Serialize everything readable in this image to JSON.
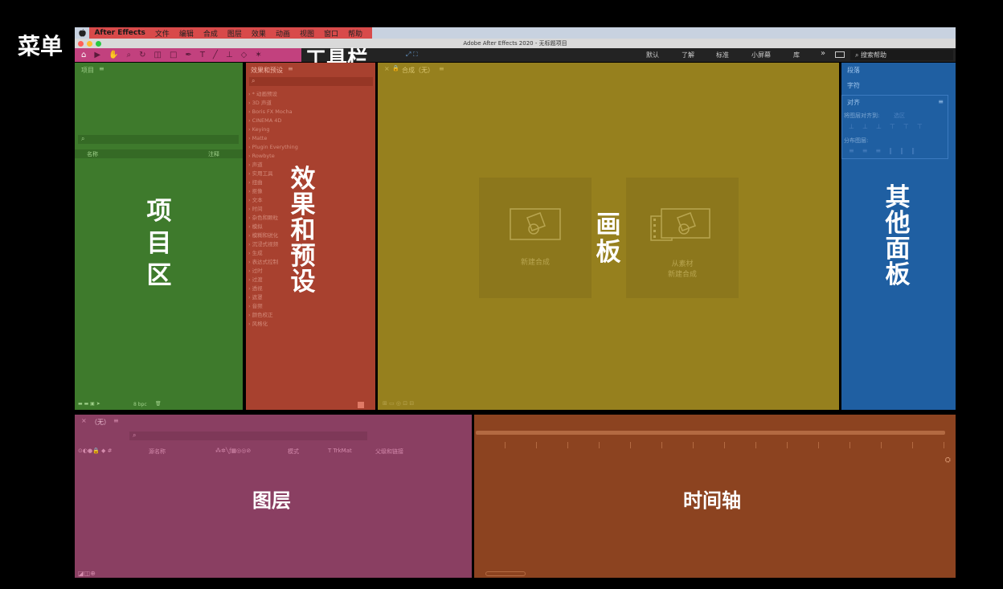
{
  "labels": {
    "menu": "菜单",
    "toolbar": "工具栏",
    "project_area": "项目区",
    "effects_presets": "效果和预设",
    "canvas": "画板",
    "other_panels": "其他面板",
    "layers": "图层",
    "timeline": "时间轴"
  },
  "menubar": {
    "app_name": "After Effects",
    "items": [
      "文件",
      "编辑",
      "合成",
      "图层",
      "效果",
      "动画",
      "视图",
      "窗口",
      "帮助"
    ]
  },
  "window": {
    "title": "Adobe After Effects 2020 - 无标题项目"
  },
  "toolbar": {
    "workspaces": [
      "默认",
      "了解",
      "标准",
      "小屏幕",
      "库"
    ],
    "search_placeholder": "搜索帮助"
  },
  "project_panel": {
    "tab": "项目",
    "col_name": "名称",
    "col_comment": "注释",
    "bpc": "8 bpc"
  },
  "effects_panel": {
    "tab": "效果和预设",
    "items": [
      "* 动画预设",
      "3D 声道",
      "Boris FX Mocha",
      "CINEMA 4D",
      "Keying",
      "Matte",
      "Plugin Everything",
      "Rowbyte",
      "声道",
      "实用工具",
      "扭曲",
      "抠像",
      "文本",
      "时间",
      "杂色和颗粒",
      "模拟",
      "模糊和锐化",
      "沉浸式视频",
      "生成",
      "表达式控制",
      "过时",
      "过渡",
      "透视",
      "遮罩",
      "音频",
      "颜色校正",
      "风格化"
    ]
  },
  "comp_panel": {
    "tab": "合成（无）",
    "new_comp": "新建合成",
    "from_footage_line1": "从素材",
    "from_footage_line2": "新建合成"
  },
  "other_panel": {
    "paragraph": "段落",
    "character": "字符",
    "align": "对齐",
    "align_to": "将图层对齐到:",
    "selection": "选区",
    "distribute": "分布图层:"
  },
  "layers_panel": {
    "tab": "（无）",
    "col_source": "源名称",
    "col_mode": "模式",
    "col_trkmat": "T TrkMat",
    "col_parent": "父级和链接"
  },
  "colors": {
    "menu_highlight": "#d84a4a",
    "toolbar_highlight": "#c2417e",
    "project": "#3e7a2c",
    "effects": "#a8412f",
    "comp": "#96801e",
    "other": "#1f5fa2",
    "layers": "#8a3f62",
    "timeline": "#8c4320"
  }
}
